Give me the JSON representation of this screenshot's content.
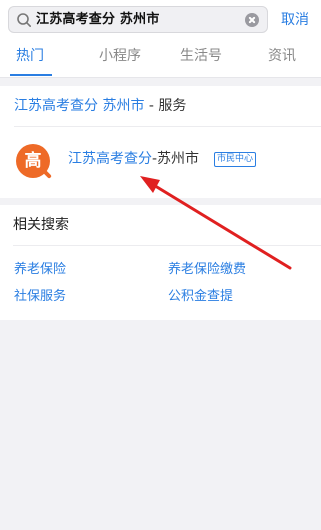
{
  "search": {
    "query": "江苏高考查分 苏州市",
    "cancel_label": "取消"
  },
  "tabs": [
    {
      "label": "热门",
      "active": true
    },
    {
      "label": "小程序",
      "active": false
    },
    {
      "label": "生活号",
      "active": false
    },
    {
      "label": "资讯",
      "active": false
    }
  ],
  "service": {
    "heading_highlight": "江苏高考查分 苏州市",
    "heading_suffix": " - 服务",
    "app": {
      "logo_char": "高",
      "name_highlight": "江苏高考查分",
      "name_suffix": "-苏州市",
      "badge": "市民中心"
    }
  },
  "related": {
    "title": "相关搜索",
    "items": [
      "养老保险",
      "养老保险缴费",
      "社保服务",
      "公积金查提"
    ]
  },
  "colors": {
    "accent": "#2a7ee2",
    "logo": "#ee6a27",
    "arrow": "#e02020"
  }
}
